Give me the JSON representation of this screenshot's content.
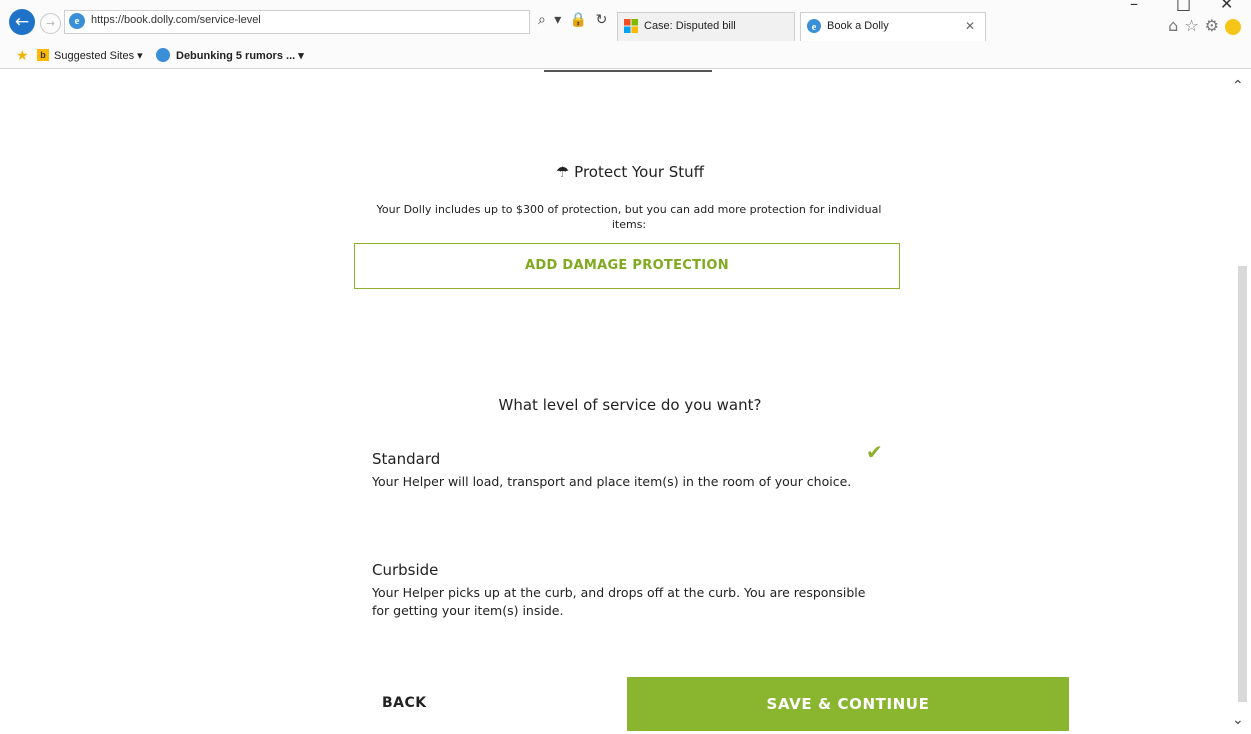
{
  "browser": {
    "url": "https://book.dolly.com/service-level",
    "tabs": [
      {
        "label": "Case: Disputed bill",
        "active": false
      },
      {
        "label": "Book a Dolly",
        "active": true
      }
    ],
    "favorites": {
      "suggested": "Suggested Sites ▾",
      "debunking": "Debunking 5 rumors ... ▾"
    },
    "addr_tools": "⌕ ▾ 🔒 ↻"
  },
  "protection": {
    "title": "☂ Protect Your Stuff",
    "description": "Your Dolly includes up to $300 of protection, but you can add more protection for individual items:",
    "button_label": "ADD DAMAGE PROTECTION"
  },
  "service": {
    "question": "What level of service do you want?",
    "options": [
      {
        "title": "Standard",
        "description": "Your Helper will load, transport and place item(s) in the room of your choice.",
        "selected": true
      },
      {
        "title": "Curbside",
        "description": "Your Helper picks up at the curb, and drops off at the curb. You are responsible for getting your item(s) inside.",
        "selected": false
      }
    ]
  },
  "footer": {
    "back_label": "BACK",
    "continue_label": "SAVE & CONTINUE"
  },
  "colors": {
    "accent": "#8ab52f",
    "accent_text": "#7faa1e",
    "ie_blue": "#1e73c8"
  }
}
